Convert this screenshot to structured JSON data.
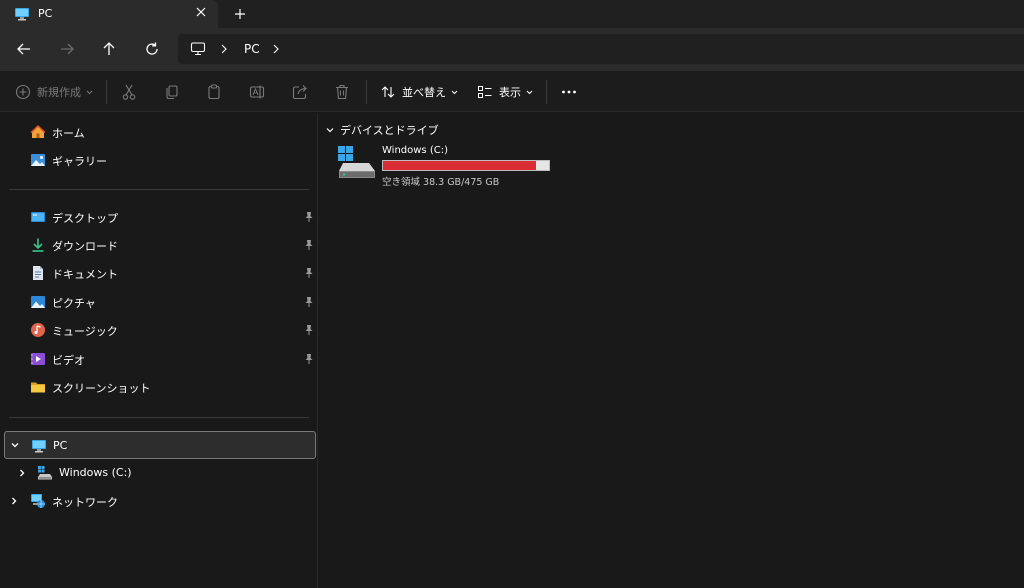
{
  "tab": {
    "title": "PC",
    "icon": "monitor-icon"
  },
  "address": {
    "segments": [
      "PC"
    ],
    "icon": "monitor-icon"
  },
  "toolbar": {
    "new_label": "新規作成",
    "sort_label": "並べ替え",
    "view_label": "表示"
  },
  "sidebar": {
    "top": [
      {
        "label": "ホーム",
        "icon": "home-icon"
      },
      {
        "label": "ギャラリー",
        "icon": "gallery-icon"
      }
    ],
    "pinned": [
      {
        "label": "デスクトップ",
        "icon": "desktop-icon",
        "pinned": true
      },
      {
        "label": "ダウンロード",
        "icon": "download-icon",
        "pinned": true
      },
      {
        "label": "ドキュメント",
        "icon": "document-icon",
        "pinned": true
      },
      {
        "label": "ピクチャ",
        "icon": "pictures-icon",
        "pinned": true
      },
      {
        "label": "ミュージック",
        "icon": "music-icon",
        "pinned": true
      },
      {
        "label": "ビデオ",
        "icon": "video-icon",
        "pinned": true
      },
      {
        "label": "スクリーンショット",
        "icon": "folder-icon",
        "pinned": false
      }
    ],
    "tree": [
      {
        "label": "PC",
        "icon": "monitor-icon",
        "expanded": true,
        "selected": true
      },
      {
        "label": "Windows (C:)",
        "icon": "drive-icon",
        "expanded": false
      },
      {
        "label": "ネットワーク",
        "icon": "network-icon",
        "expanded": false
      }
    ]
  },
  "content": {
    "group_title": "デバイスとドライブ",
    "drives": [
      {
        "name": "Windows (C:)",
        "space_text": "空き領域 38.3 GB/475 GB",
        "used_fraction": 0.919,
        "bar_color": "#da2d33"
      }
    ]
  },
  "colors": {
    "background": "#191919",
    "toolbar": "#1c1c1c",
    "navbar": "#2b2b2b",
    "accent_blue": "#4cc2ff"
  }
}
